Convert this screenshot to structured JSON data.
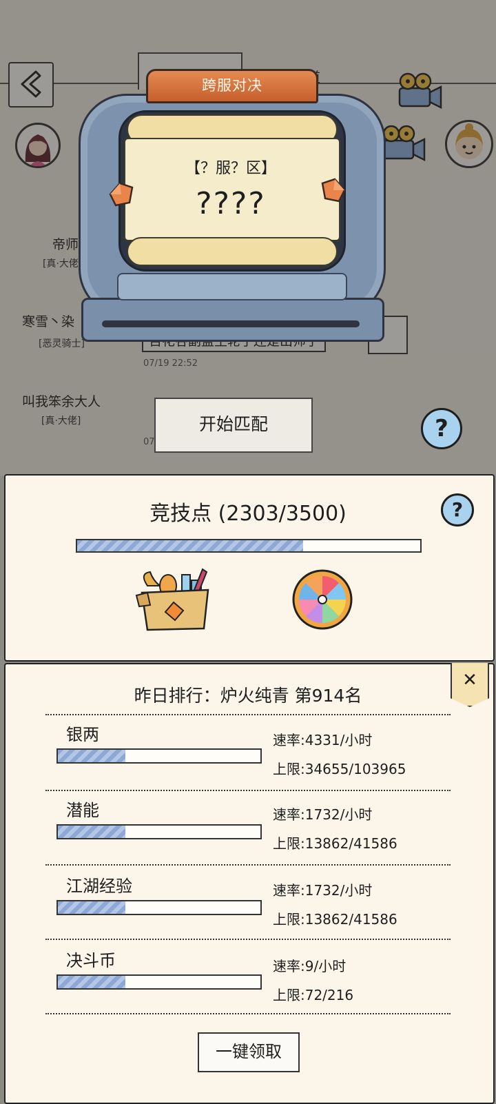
{
  "background_chat": {
    "channel_label": "频道",
    "messages": [
      {
        "name": "帝师",
        "title": "[真·大佬]",
        "bubble": "",
        "time": ""
      },
      {
        "name": "寒雪丶染",
        "title": "[恶灵骑士]",
        "bubble": "百花谷副盟主轮了还是出师了",
        "time": "07/19 22:52"
      },
      {
        "name": "叫我笨余大人",
        "title": "[真·大佬]",
        "bubble": "",
        "time": "07"
      }
    ]
  },
  "match_machine": {
    "title": "跨服对决",
    "server_text": "【？服？区】",
    "opponent_name": "????",
    "start_button": "开始匹配"
  },
  "arena": {
    "points_label": "竞技点",
    "points_value": "(2303/3500)",
    "points_fraction": 0.658,
    "icons": [
      "gift-box-icon",
      "lucky-wheel-icon"
    ]
  },
  "ranking": {
    "text": "昨日排行：炉火纯青 第914名",
    "resources": [
      {
        "name": "银两",
        "rate": "速率:4331/小时",
        "cap": "上限:34655/103965",
        "fill": 0.333
      },
      {
        "name": "潜能",
        "rate": "速率:1732/小时",
        "cap": "上限:13862/41586",
        "fill": 0.333
      },
      {
        "name": "江湖经验",
        "rate": "速率:1732/小时",
        "cap": "上限:13862/41586",
        "fill": 0.333
      },
      {
        "name": "决斗币",
        "rate": "速率:9/小时",
        "cap": "上限:72/216",
        "fill": 0.333
      }
    ],
    "claim_button": "一键领取"
  },
  "icons": {
    "help": "?",
    "close": "✕"
  },
  "colors": {
    "tab_orange": "#d9733d",
    "machine_blue": "#7d93ad",
    "panel_cream": "#fbf6e9",
    "bar_blue": "#8ea8d6",
    "help_blue": "#a8d2ee"
  }
}
